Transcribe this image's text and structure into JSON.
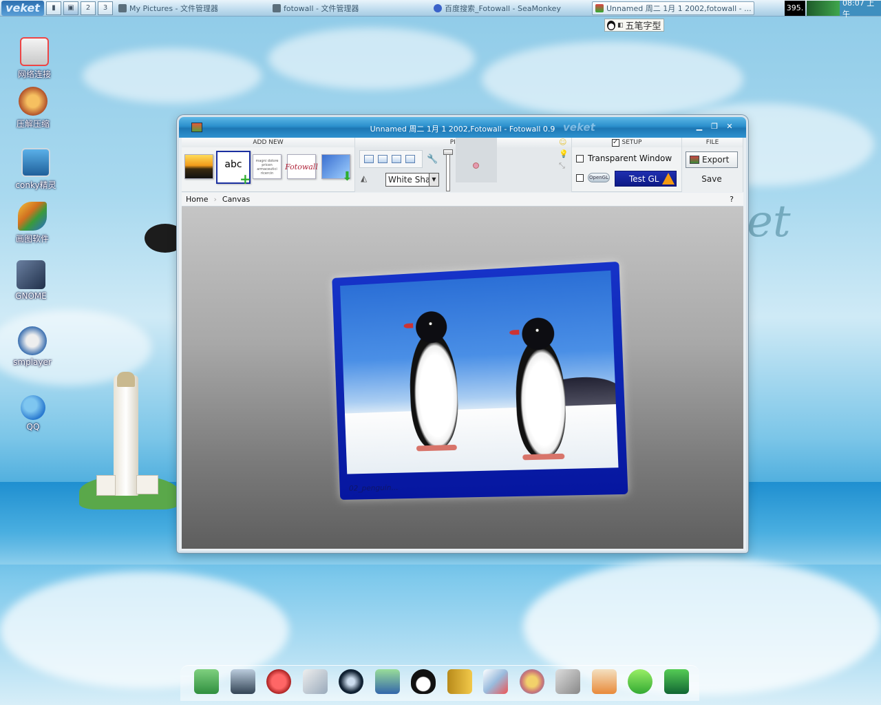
{
  "taskbar": {
    "logo": "veket",
    "desktops": [
      "2",
      "3"
    ],
    "tasks": [
      {
        "label": "My Pictures - 文件管理器"
      },
      {
        "label": "fotowall - 文件管理器"
      },
      {
        "label": "百度搜索_Fotowall - SeaMonkey"
      },
      {
        "label": "Unnamed 周二 1月 1 2002,fotowall - ..."
      }
    ],
    "cpu": "395.",
    "clock": "08:07 上午"
  },
  "ime": {
    "label": "五笔字型"
  },
  "desktop_icons": [
    {
      "label": "网络连接",
      "icon": "network-icon"
    },
    {
      "label": "压解压缩",
      "icon": "archive-icon"
    },
    {
      "label": "conky精灵",
      "icon": "conky-icon"
    },
    {
      "label": "画图软件",
      "icon": "paint-icon"
    },
    {
      "label": "GNOME",
      "icon": "gnome-icon"
    },
    {
      "label": "smplayer",
      "icon": "smplayer-icon"
    },
    {
      "label": "QQ",
      "icon": "qq-icon"
    }
  ],
  "window": {
    "title": "Unnamed 周二 1月 1 2002,Fotowall - Fotowall 0.9",
    "watermark": "veket",
    "groups": {
      "add_new": "ADD NEW",
      "picture": "PICTURE",
      "setup": "SETUP",
      "file": "FILE"
    },
    "add_new": {
      "abc_label": "abc",
      "fotowall_label": "Fotowall",
      "text_sample": "magni dolore pricen armaceutici ricercin"
    },
    "picture": {
      "background_value": "White Shape"
    },
    "setup": {
      "checked": true,
      "transparent_label": "Transparent Window",
      "transparent_checked": false,
      "opengl_checked": false,
      "opengl_badge": "OpenGL",
      "test_gl_label": "Test GL"
    },
    "file": {
      "export_label": "Export",
      "save_label": "Save"
    },
    "breadcrumb": [
      "Home",
      "Canvas"
    ],
    "help_label": "?",
    "canvas": {
      "photo_caption": "02_penguin..."
    }
  },
  "background": {
    "watermark": "et"
  },
  "dock": [
    "file-manager-icon",
    "monitor-icon",
    "pet-icon",
    "editor-icon",
    "media-player-icon",
    "network-tools-icon",
    "qq-penguin-icon",
    "book-icon",
    "presentation-icon",
    "paint-palette-icon",
    "usb-icon",
    "scanner-icon",
    "help-icon",
    "camera-icon"
  ]
}
